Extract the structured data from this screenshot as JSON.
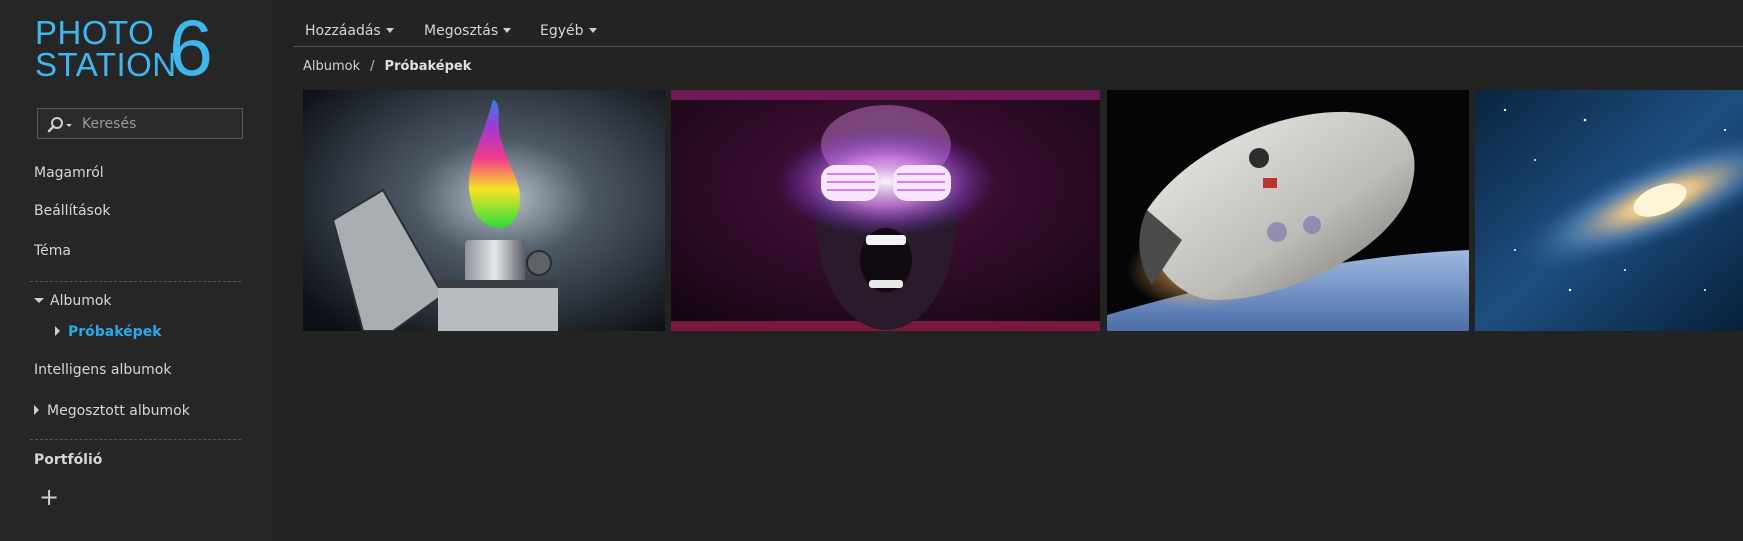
{
  "app": {
    "logo_line1": "PHOTO",
    "logo_line2": "STATION",
    "logo_version": "6"
  },
  "search": {
    "placeholder": "Keresés"
  },
  "sidebar": {
    "about": "Magamról",
    "settings": "Beállítások",
    "theme": "Téma",
    "albums": "Albumok",
    "albums_child": "Próbaképek",
    "smart_albums": "Intelligens albumok",
    "shared_albums": "Megosztott albumok",
    "portfolio": "Portfólió",
    "add_symbol": "+"
  },
  "toolbar": {
    "add": "Hozzáadás",
    "share": "Megosztás",
    "other": "Egyéb"
  },
  "breadcrumb": {
    "root": "Albumok",
    "separator": "/",
    "current": "Próbaképek"
  },
  "photos": [
    {
      "subject": "rainbow-flame-lighter"
    },
    {
      "subject": "glowing-shutter-glasses-face"
    },
    {
      "subject": "spacex-dragon-capsule"
    },
    {
      "subject": "spiral-galaxy"
    }
  ],
  "colors": {
    "accent": "#3fb6ee",
    "active_link": "#29a8ec",
    "background": "#232323"
  }
}
